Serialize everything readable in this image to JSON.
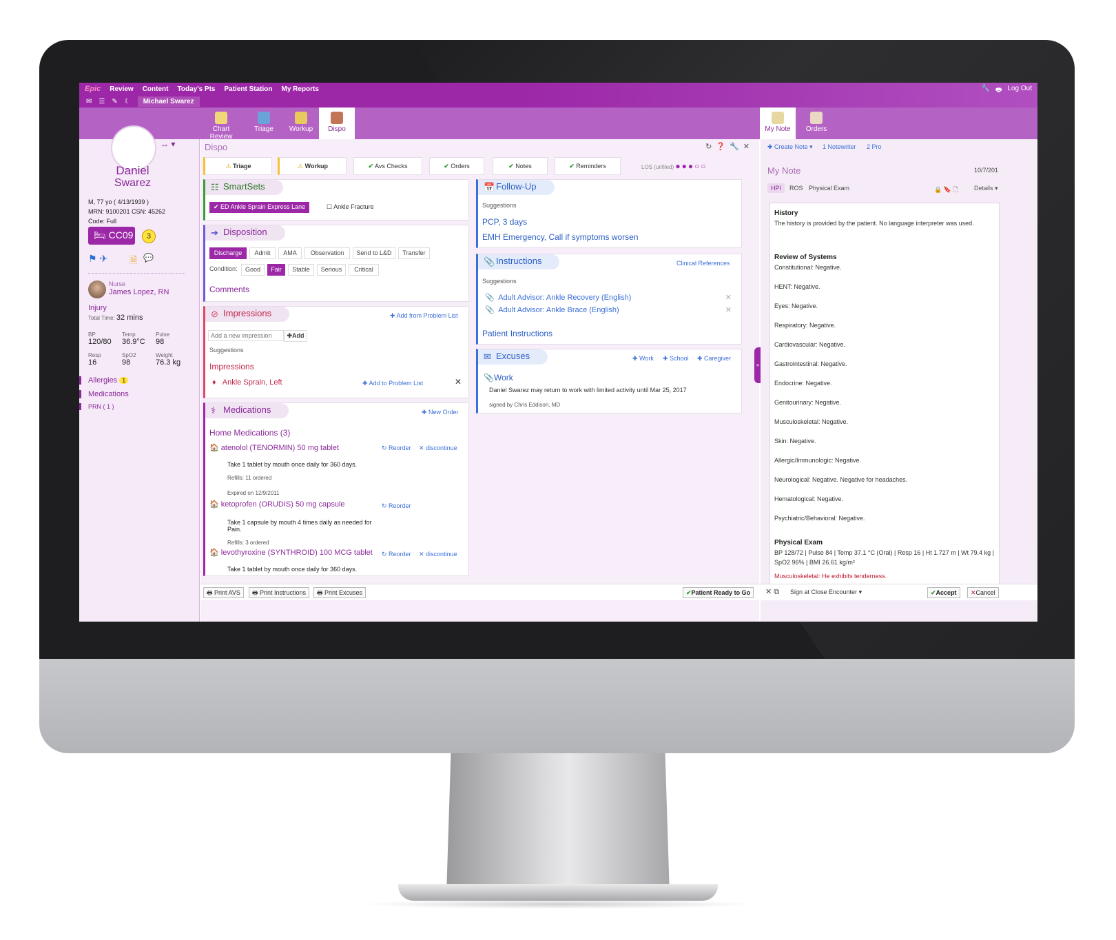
{
  "topbar": {
    "logo": "Epic",
    "menu": [
      "Review",
      "Content",
      "Today's Pts",
      "Patient Station",
      "My Reports"
    ],
    "logout": "Log Out",
    "patient_tab": "Michael Swarez"
  },
  "activity_tabs": [
    "Chart Review",
    "Triage",
    "Workup",
    "Dispo"
  ],
  "note_tabs": [
    "My Note",
    "Orders"
  ],
  "patient": {
    "first": "Daniel",
    "last": "Swarez",
    "demo": "M, 77 yo ( 4/13/1939 )",
    "mrn": "MRN: 9100201 CSN: 45262",
    "code_label": "Code:",
    "code": "Full",
    "room": "CC09",
    "badge": "3",
    "nurse_role": "Nurse",
    "nurse_name": "James Lopez, RN",
    "complaint": "Injury",
    "total_time_label": "Total Time:",
    "total_time": "32 mins"
  },
  "vitals": [
    {
      "label": "BP",
      "value": "120/80"
    },
    {
      "label": "Temp",
      "value": "36.9°C"
    },
    {
      "label": "Pulse",
      "value": "98"
    },
    {
      "label": "Resp",
      "value": "16"
    },
    {
      "label": "SpO2",
      "value": "98"
    },
    {
      "label": "Weight",
      "value": "76.3 kg"
    }
  ],
  "sidenav": {
    "allergies": "Allergies",
    "allergies_count": "1",
    "medications": "Medications",
    "prn": "PRN ( 1 )"
  },
  "dispo": {
    "title": "Dispo",
    "checks": [
      "Triage",
      "Workup",
      "Avs Checks",
      "Orders",
      "Notes",
      "Reminders"
    ],
    "los": "LOS (unfiled)"
  },
  "smartsets": {
    "title": "SmartSets",
    "selected": "ED Ankle Sprain Express Lane",
    "other": "Ankle Fracture"
  },
  "disposition": {
    "title": "Disposition",
    "options": [
      "Discharge",
      "Admit",
      "AMA",
      "Observation",
      "Send to L&D",
      "Transfer"
    ],
    "condition_label": "Condition:",
    "conditions": [
      "Good",
      "Fair",
      "Stable",
      "Serious",
      "Critical"
    ],
    "comments": "Comments"
  },
  "impressions": {
    "title": "Impressions",
    "add_from": "Add from Problem List",
    "placeholder": "Add a new impression",
    "add": "Add",
    "suggestions": "Suggestions",
    "sub": "Impressions",
    "item": "Ankle Sprain, Left",
    "add_to": "Add to Problem List"
  },
  "medications": {
    "title": "Medications",
    "new_order": "New Order",
    "home": "Home Medications (3)",
    "items": [
      {
        "name": "atenolol (TENORMIN) 50 mg tablet",
        "sig": "Take 1 tablet by mouth once daily for 360 days.",
        "refill": "Refills: 11 ordered",
        "expired": "Expired on 12/9/2011"
      },
      {
        "name": "ketoprofen (ORUDIS) 50 mg capsule",
        "sig": "Take 1 capsule by mouth 4 times daily as needed for Pain.",
        "refill": "Refills: 3 ordered"
      },
      {
        "name": "levothyroxine (SYNTHROID) 100 MCG tablet",
        "sig": "Take 1 tablet by mouth once daily for 360 days."
      }
    ],
    "reorder": "Reorder",
    "discontinue": "discontinue"
  },
  "followup": {
    "title": "Follow-Up",
    "suggestions": "Suggestions",
    "items": [
      "PCP, 3 days",
      "EMH Emergency, Call if symptoms worsen"
    ]
  },
  "instructions": {
    "title": "Instructions",
    "clinical": "Clinical References",
    "suggestions": "Suggestions",
    "items": [
      "Adult Advisor: Ankle Recovery (English)",
      "Adult Advisor: Ankle Brace (English)"
    ],
    "patient": "Patient Instructions"
  },
  "excuses": {
    "title": "Excuses",
    "work_btn": "Work",
    "school_btn": "School",
    "caregiver_btn": "Caregiver",
    "work": "Work",
    "text": "Daniel Swarez may return to work with limited activity until Mar 25, 2017",
    "signed": "signed by Chris Eddison, MD"
  },
  "note": {
    "create": "Create Note",
    "notewriter": "1 Notewriter",
    "pro": "2 Pro",
    "title": "My Note",
    "date": "10/7/201",
    "tabs": [
      "HPI",
      "ROS",
      "Physical Exam"
    ],
    "details": "Details",
    "history_h": "History",
    "history": "The history is provided by the patient. No language interpreter was used.",
    "ros_h": "Review of Systems",
    "ros": [
      "Constitutional: Negative.",
      "HENT: Negative.",
      "Eyes: Negative.",
      "Respiratory: Negative.",
      "Cardiovascular: Negative.",
      "Gastrointestinal: Negative.",
      "Endocrine: Negative.",
      "Genitourinary: Negative.",
      "Musculoskeletal: Negative.",
      "Skin: Negative.",
      "Allergic/Immunologic: Negative.",
      "Neurological: Negative. Negative for headaches.",
      "Hematological: Negative.",
      "Psychiatric/Behavioral: Negative."
    ],
    "pe_h": "Physical Exam",
    "pe": "BP 128/72 | Pulse 84 | Temp 37.1 °C (Oral) | Resp 16 | Ht 1.727 m | Wt 79.4 kg | SpO2 96% | BMI 26.61 kg/m²",
    "pe_more": "Musculoskeletal: He exhibits tenderness."
  },
  "bottom": {
    "print_avs": "Print AVS",
    "print_instr": "Print Instructions",
    "print_excuses": "Print Excuses",
    "ready": "Patient Ready to Go",
    "sign": "Sign at Close Encounter",
    "accept": "Accept",
    "cancel": "Cancel"
  },
  "colors": {
    "brand": "#9c27a7",
    "link": "#3a6fd8",
    "ok": "#3a9c34"
  }
}
